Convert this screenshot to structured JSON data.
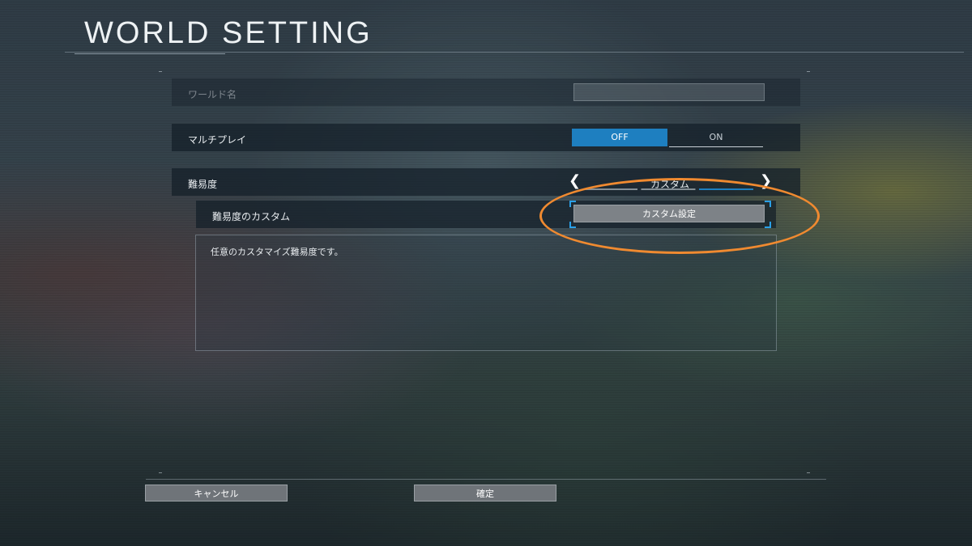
{
  "window": {
    "title": "WORLD SETTING"
  },
  "world_name": {
    "label": "ワールド名",
    "value": ""
  },
  "multiplayer": {
    "label": "マルチプレイ",
    "options": [
      "OFF",
      "ON"
    ],
    "selected": "OFF"
  },
  "difficulty": {
    "label": "難易度",
    "value": "カスタム"
  },
  "custom_difficulty": {
    "label": "難易度のカスタム",
    "button_label": "カスタム設定"
  },
  "description": {
    "text": "任意のカスタマイズ難易度です。"
  },
  "footer": {
    "cancel_label": "キャンセル",
    "confirm_label": "確定"
  },
  "colors": {
    "accent": "#1e7fc0",
    "focus": "#2aa0e8",
    "highlight_annotation": "#f08a30"
  }
}
